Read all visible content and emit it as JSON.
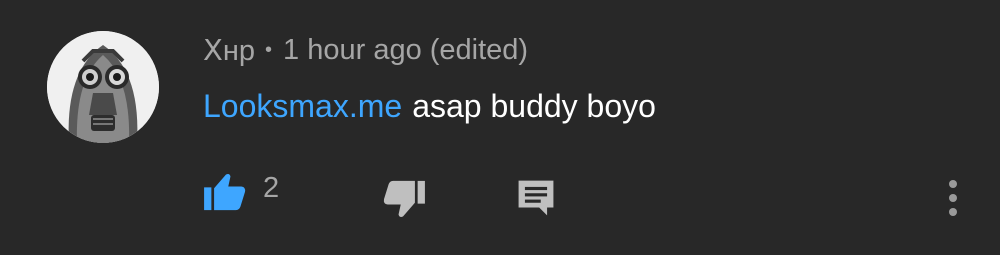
{
  "comment": {
    "author": "Ⅹнр",
    "separator": "•",
    "time": "1 hour ago (edited)",
    "link_text": "Looksmax.me",
    "text": "asap buddy boyo",
    "like_count": "2"
  },
  "icons": {
    "like": "thumbs-up-icon",
    "dislike": "thumbs-down-icon",
    "reply": "reply-comment-icon",
    "more": "more-vertical-icon"
  },
  "colors": {
    "background": "#282828",
    "link": "#3ea6ff",
    "like_active": "#3ea6ff",
    "secondary_text": "#a6a6a6",
    "primary_text": "#ffffff"
  }
}
